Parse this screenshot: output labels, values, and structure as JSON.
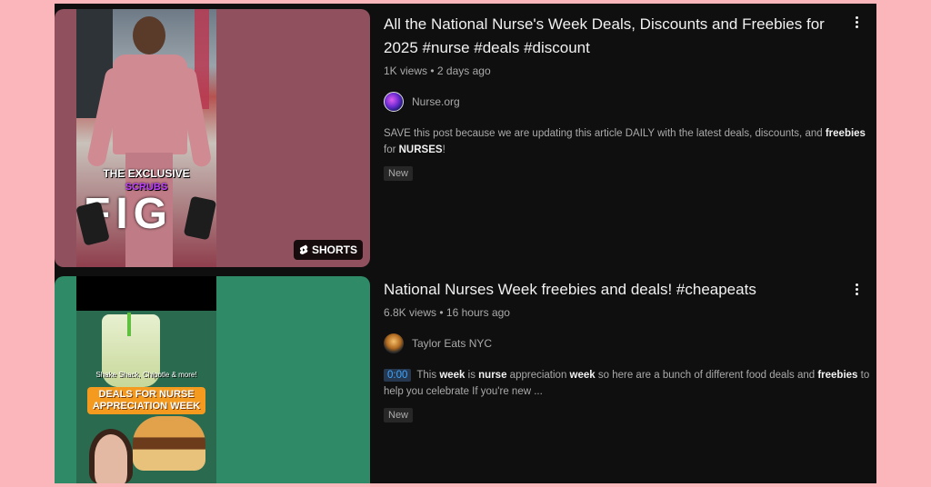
{
  "results": [
    {
      "title": "All the National Nurse's Week Deals, Discounts and Freebies for 2025 #nurse #deals #discount",
      "views": "1K views",
      "age": "2 days ago",
      "channel": "Nurse.org",
      "description_parts": [
        "SAVE this post because we are updating this article DAILY with the latest deals, discounts, and ",
        "freebies",
        " for ",
        "NURSES",
        "!"
      ],
      "badge": "New",
      "thumbnail": {
        "badge_label": "SHORTS",
        "badge_icon": "shorts-icon",
        "overlay_line1": "THE EXCLUSIVE",
        "overlay_line2": "SCRUBS",
        "brand": "FIG"
      },
      "menu_icon": "more-vertical-icon"
    },
    {
      "title": "National Nurses Week freebies and deals! #cheapeats",
      "views": "6.8K views",
      "age": "16 hours ago",
      "channel": "Taylor Eats NYC",
      "timestamp": "0:00",
      "description_parts": [
        " This ",
        "week",
        " is ",
        "nurse",
        " appreciation ",
        "week",
        " so here are a bunch of different food deals and ",
        "freebies",
        " to help you celebrate If you're new ..."
      ],
      "badge": "New",
      "thumbnail": {
        "caption": "Shake Shack, Chipotle & more!",
        "overlay_line1": "DEALS FOR NURSE",
        "overlay_line2": "APPRECIATION WEEK"
      },
      "menu_icon": "more-vertical-icon"
    }
  ],
  "colors": {
    "page_background": "#fbb6bb",
    "panel_background": "#0f0f0f",
    "thumb1_background": "#91505e",
    "thumb2_background": "#2f8a68",
    "link_blue": "#3ea6ff"
  }
}
